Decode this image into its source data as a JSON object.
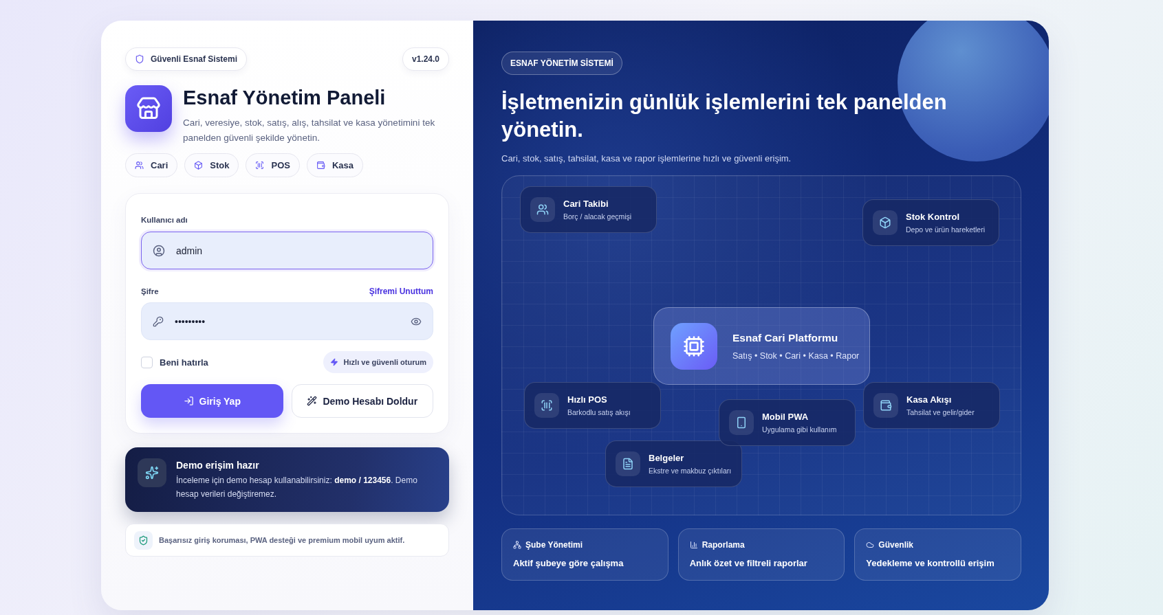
{
  "badge": {
    "label": "Güvenli Esnaf Sistemi"
  },
  "version": "v1.24.0",
  "brand": {
    "title": "Esnaf Yönetim Paneli",
    "subtitle": "Cari, veresiye, stok, satış, alış, tahsilat ve kasa yönetimini tek panelden güvenli şekilde yönetin."
  },
  "modules": [
    {
      "kind": "users",
      "label": "Cari"
    },
    {
      "kind": "box",
      "label": "Stok"
    },
    {
      "kind": "barcode",
      "label": "POS"
    },
    {
      "kind": "wallet",
      "label": "Kasa"
    }
  ],
  "login": {
    "username": {
      "label": "Kullanıcı adı",
      "value": "admin",
      "focused": true
    },
    "password": {
      "label": "Şifre",
      "value": "•••••••••",
      "focused": false,
      "forgot": "Şifremi Unuttum"
    },
    "remember": {
      "label": "Beni hatırla",
      "checked": false
    },
    "session_badge": "Hızlı ve güvenli oturum",
    "buttons": [
      {
        "kind": "primary",
        "label": "Giriş Yap"
      },
      {
        "kind": "secondary",
        "label": "Demo Hesabı Doldur"
      }
    ]
  },
  "demo_notice": {
    "title": "Demo erişim hazır",
    "text": "İnceleme için demo hesap kullanabilirsiniz: **demo / 123456**. Demo hesap verileri değiştiremez."
  },
  "security_note": "Başarısız giriş koruması, PWA desteği ve premium mobil uyum aktif.",
  "hero": {
    "eyebrow": "ESNAF YÖNETİM SİSTEMİ",
    "title": "İşletmenizin günlük işlemlerini tek panelden yönetin.",
    "subtitle": "Cari, stok, satış, tahsilat, kasa ve rapor işlemlerine hızlı ve güvenli erişim."
  },
  "diagram": {
    "center": {
      "title": "Esnaf Cari Platformu",
      "subtitle": "Satış • Stok • Cari • Kasa • Rapor"
    },
    "nodes": [
      {
        "kind": "users",
        "title": "Cari Takibi",
        "subtitle": "Borç / alacak geçmişi"
      },
      {
        "kind": "box",
        "title": "Stok Kontrol",
        "subtitle": "Depo ve ürün hareketleri"
      },
      {
        "kind": "barcode",
        "title": "Hızlı POS",
        "subtitle": "Barkodlu satış akışı"
      },
      {
        "kind": "document",
        "title": "Belgeler",
        "subtitle": "Ekstre ve makbuz çıktıları"
      },
      {
        "kind": "wallet",
        "title": "Kasa Akışı",
        "subtitle": "Tahsilat ve gelir/gider"
      },
      {
        "kind": "phone",
        "title": "Mobil PWA",
        "subtitle": "Uygulama gibi kullanım"
      }
    ]
  },
  "features": [
    {
      "kind": "branches",
      "title": "Şube Yönetimi",
      "text": "Aktif şubeye göre çalışma"
    },
    {
      "kind": "chart",
      "title": "Raporlama",
      "text": "Anlık özet ve filtreli raporlar"
    },
    {
      "kind": "cloud",
      "title": "Güvenlik",
      "text": "Yedekleme ve kontrollü erişim"
    }
  ]
}
